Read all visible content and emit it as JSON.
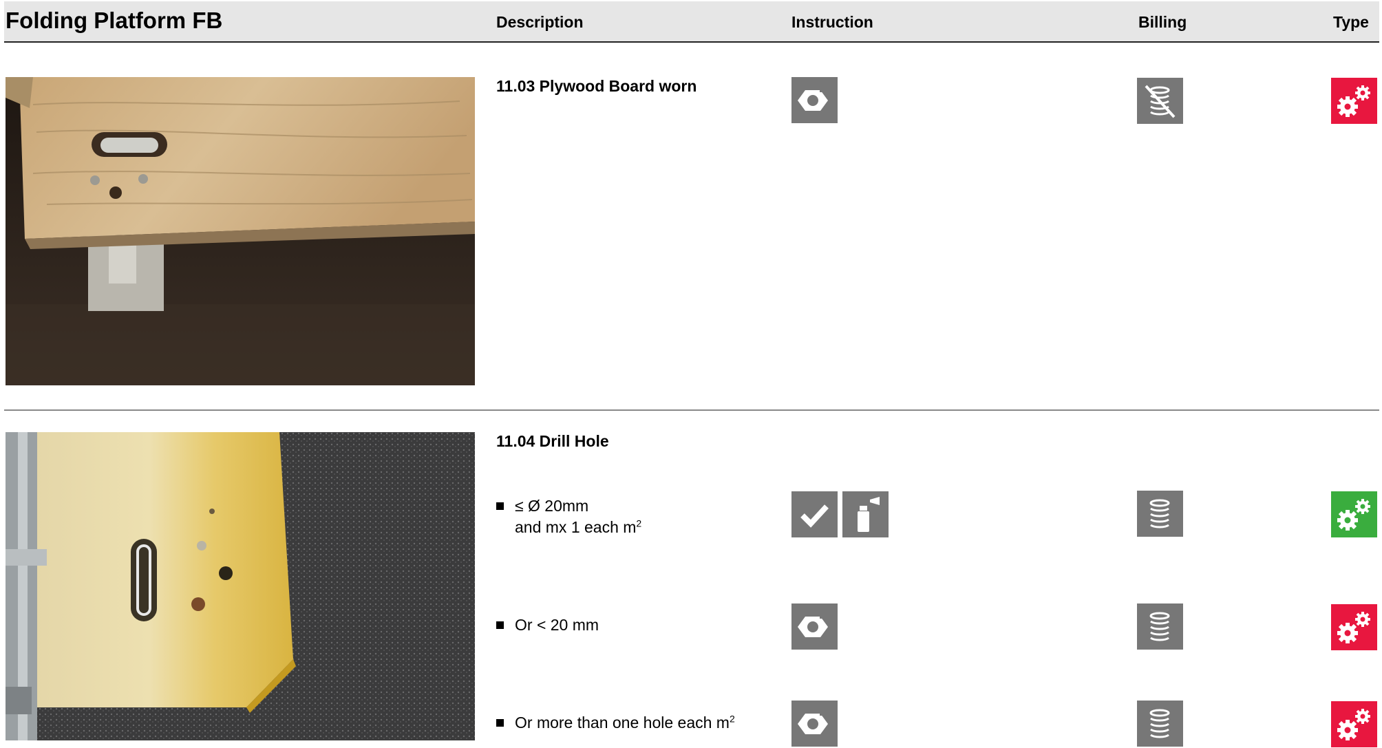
{
  "header": {
    "title": "Folding Platform FB",
    "columns": {
      "description": "Description",
      "instruction": "Instruction",
      "billing": "Billing",
      "type": "Type"
    }
  },
  "sections": [
    {
      "title": "11.03 Plywood Board worn",
      "rows": [
        {
          "instruction_icons": [
            "hex-nut-icon"
          ],
          "billing_icon": "no-billing-coin-stack-icon",
          "type_icon": "gears-icon",
          "type_color": "#e8173f"
        }
      ]
    },
    {
      "title": "11.04 Drill Hole",
      "rows": [
        {
          "line1": "≤ Ø 20mm",
          "line2_prefix": "and mx 1 each m",
          "line2_sup": "2",
          "instruction_icons": [
            "checkmark-icon",
            "spray-can-icon"
          ],
          "billing_icon": "coin-stack-icon",
          "type_icon": "gears-icon",
          "type_color": "#3aad3e"
        },
        {
          "line1": "Or < 20 mm",
          "instruction_icons": [
            "hex-nut-icon"
          ],
          "billing_icon": "coin-stack-icon",
          "type_icon": "gears-icon",
          "type_color": "#e8173f"
        },
        {
          "line1_prefix": "Or more than one hole each m",
          "line1_sup": "2",
          "instruction_icons": [
            "hex-nut-icon"
          ],
          "billing_icon": "coin-stack-icon",
          "type_icon": "gears-icon",
          "type_color": "#e8173f"
        }
      ]
    }
  ],
  "colors": {
    "icon_gray": "#777777",
    "type_red": "#e8173f",
    "type_green": "#3aad3e",
    "header_bg": "#e6e6e6"
  }
}
